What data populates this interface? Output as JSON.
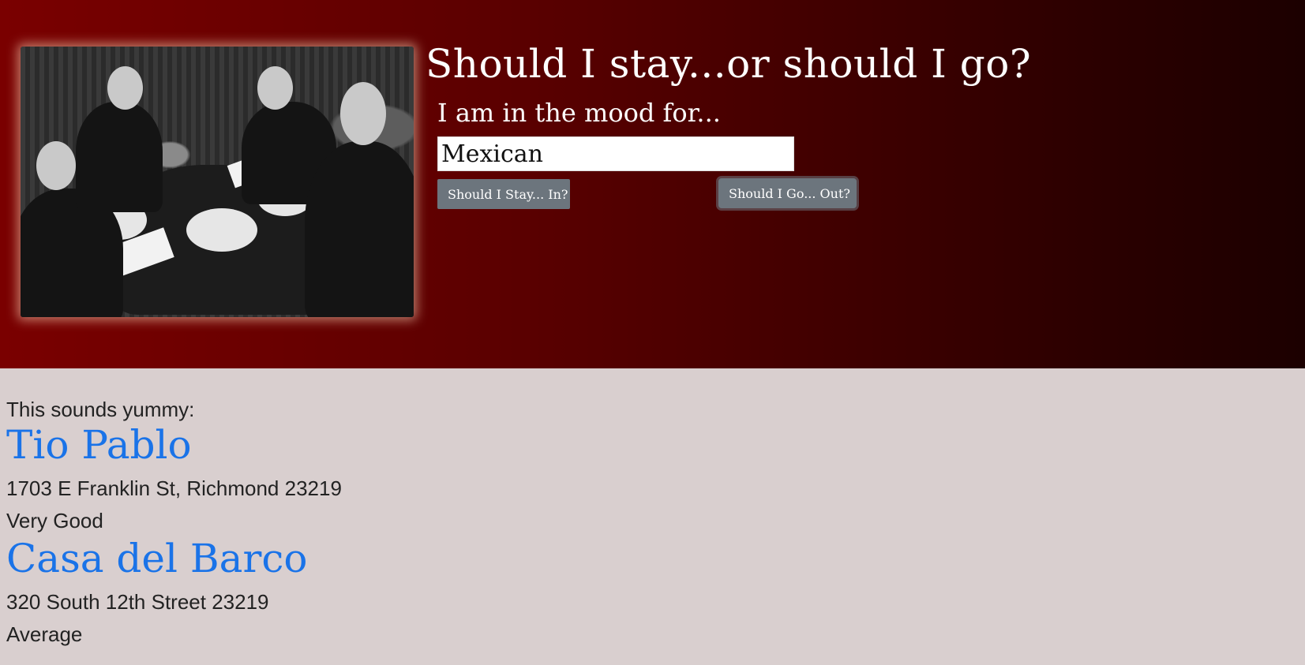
{
  "header": {
    "title": "Should I stay...or should I go?",
    "mood_label": "I am in the mood for...",
    "mood_value": "Mexican",
    "stay_in_label": "Should I Stay... In?",
    "go_out_label": "Should I Go... Out?"
  },
  "results": {
    "intro": "This sounds yummy:",
    "restaurants": [
      {
        "name": "Tio Pablo",
        "address": "1703 E Franklin St, Richmond 23219",
        "rating": "Very Good"
      },
      {
        "name": "Casa del Barco",
        "address": "320 South 12th Street 23219",
        "rating": "Average"
      }
    ]
  },
  "colors": {
    "hero_start": "#7a0000",
    "hero_end": "#1c0000",
    "page_bg": "#d9cfcf",
    "link": "#1a73e8",
    "button": "#6c757d"
  }
}
